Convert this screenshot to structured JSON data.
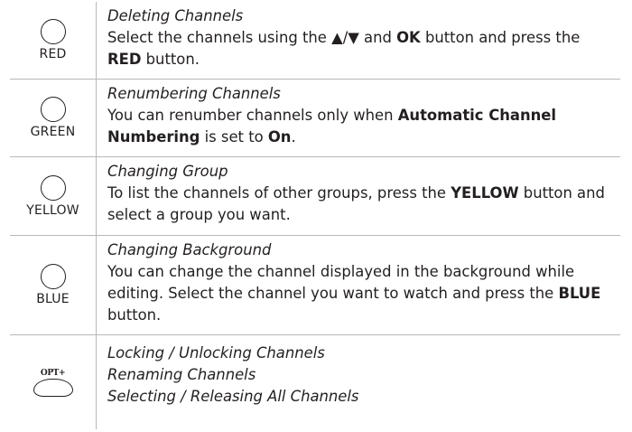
{
  "rows": [
    {
      "button_label": "RED",
      "title": "Deleting Channels",
      "desc": [
        {
          "t": "Select the channels using the "
        },
        {
          "t": "▲/▼",
          "b": false
        },
        {
          "t": " and "
        },
        {
          "t": "OK",
          "b": true
        },
        {
          "t": " button and press the "
        },
        {
          "t": "RED",
          "b": true
        },
        {
          "t": " button."
        }
      ]
    },
    {
      "button_label": "GREEN",
      "title": "Renumbering Channels",
      "desc": [
        {
          "t": "You can renumber channels only when "
        },
        {
          "t": "Automatic Channel Numbering",
          "b": true
        },
        {
          "t": " is set to "
        },
        {
          "t": "On",
          "b": true
        },
        {
          "t": "."
        }
      ]
    },
    {
      "button_label": "YELLOW",
      "title": "Changing Group",
      "desc": [
        {
          "t": "To list the channels of other groups, press the "
        },
        {
          "t": "YELLOW",
          "b": true
        },
        {
          "t": " button and select a group you want."
        }
      ]
    },
    {
      "button_label": "BLUE",
      "title": "Changing Background",
      "desc": [
        {
          "t": "You can change the channel displayed in the background while editing. Select the channel you want to watch and press the "
        },
        {
          "t": "BLUE",
          "b": true
        },
        {
          "t": " button."
        }
      ]
    },
    {
      "button_label": "OPT+",
      "titles": [
        "Locking / Unlocking Channels",
        "Renaming Channels",
        "Selecting / Releasing All Channels"
      ]
    }
  ]
}
